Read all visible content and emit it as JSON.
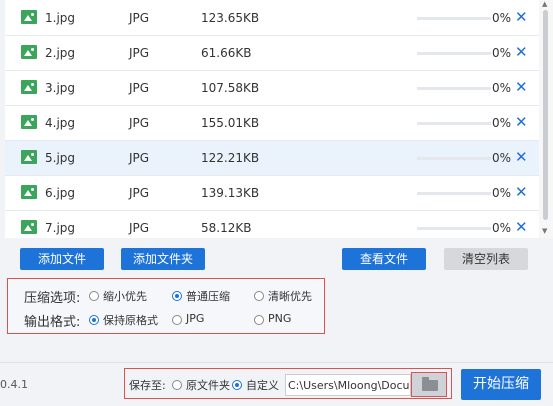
{
  "files": [
    {
      "name": "1.jpg",
      "type": "JPG",
      "size": "123.65KB",
      "progress": "0%"
    },
    {
      "name": "2.jpg",
      "type": "JPG",
      "size": "61.66KB",
      "progress": "0%"
    },
    {
      "name": "3.jpg",
      "type": "JPG",
      "size": "107.58KB",
      "progress": "0%"
    },
    {
      "name": "4.jpg",
      "type": "JPG",
      "size": "155.01KB",
      "progress": "0%"
    },
    {
      "name": "5.jpg",
      "type": "JPG",
      "size": "122.21KB",
      "progress": "0%"
    },
    {
      "name": "6.jpg",
      "type": "JPG",
      "size": "139.13KB",
      "progress": "0%"
    },
    {
      "name": "7.jpg",
      "type": "JPG",
      "size": "58.12KB",
      "progress": "0%"
    }
  ],
  "delete_glyph": "✕",
  "buttons": {
    "add_file": "添加文件",
    "add_folder": "添加文件夹",
    "view_file": "查看文件",
    "clear_list": "清空列表",
    "start": "开始压缩"
  },
  "compress": {
    "label": "压缩选项:",
    "options": [
      "缩小优先",
      "普通压缩",
      "清晰优先"
    ],
    "selected": "普通压缩"
  },
  "format": {
    "label": "输出格式:",
    "options": [
      "保持原格式",
      "JPG",
      "PNG"
    ],
    "selected": "保持原格式"
  },
  "save": {
    "label": "保存至:",
    "options": [
      "原文件夹",
      "自定义"
    ],
    "selected": "自定义",
    "path": "C:\\Users\\Mloong\\Documents"
  },
  "version": "0.4.1",
  "colors": {
    "accent": "#1e73d9",
    "highlight_border": "#d9534f",
    "file_icon": "#3aa55b"
  }
}
